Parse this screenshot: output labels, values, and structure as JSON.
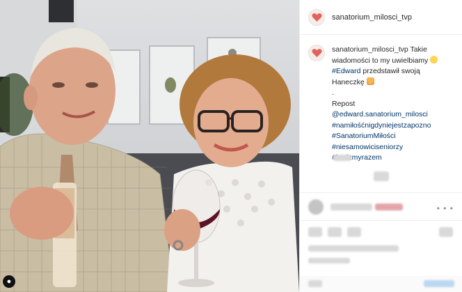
{
  "post": {
    "username": "sanatorium_milosci_tvp",
    "caption": {
      "author": "sanatorium_milosci_tvp",
      "line1_rest": " Takie",
      "line2": "wiadomości to my uwielbiamy",
      "line3_tag": "#Edward",
      "line3_rest": " przedstawił swoją",
      "line4": "Haneczkę",
      "dot": ".",
      "repost": "Repost",
      "mention": "@edward.sanatorium_milosci",
      "tags": [
        "#namiłośćnigdyniejestzapozno",
        "#SanatoriumMiłości",
        "#niesamowiciseniorzy",
        "#badzmyrazem"
      ]
    },
    "more_label": "• • •"
  },
  "icons": {
    "avatar": "heart-icon",
    "user_tag": "person-icon",
    "emoji1": "heart-eyes-emoji",
    "emoji2": "couple-emoji"
  },
  "colors": {
    "hashtag": "#003569",
    "text": "#262626",
    "brand_heart": "#e0635e"
  }
}
